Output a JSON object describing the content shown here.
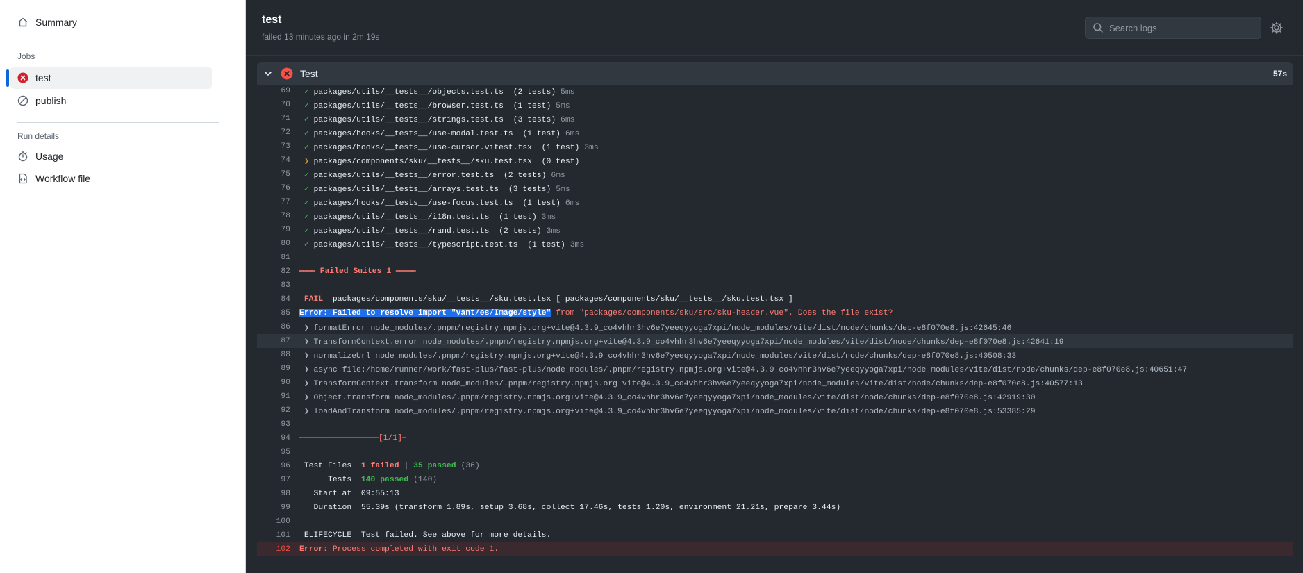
{
  "sidebar": {
    "summary": "Summary",
    "jobs_heading": "Jobs",
    "jobs": [
      {
        "label": "test",
        "status": "failed"
      },
      {
        "label": "publish",
        "status": "skipped"
      }
    ],
    "run_details_heading": "Run details",
    "details": [
      {
        "label": "Usage",
        "icon": "stopwatch-icon"
      },
      {
        "label": "Workflow file",
        "icon": "file-code-icon"
      }
    ]
  },
  "header": {
    "title": "test",
    "subtitle": "failed 13 minutes ago in 2m 19s",
    "search_placeholder": "Search logs"
  },
  "step": {
    "name": "Test",
    "duration": "57s",
    "status": "failed"
  },
  "log": {
    "passed_tests": [
      {
        "n": "69",
        "check": "✓",
        "path": "packages/utils/__tests__/objects.test.ts",
        "count": "(2 tests)",
        "time": "5ms"
      },
      {
        "n": "70",
        "check": "✓",
        "path": "packages/utils/__tests__/browser.test.ts",
        "count": "(1 test)",
        "time": "5ms"
      },
      {
        "n": "71",
        "check": "✓",
        "path": "packages/utils/__tests__/strings.test.ts",
        "count": "(3 tests)",
        "time": "6ms"
      },
      {
        "n": "72",
        "check": "✓",
        "path": "packages/hooks/__tests__/use-modal.test.ts",
        "count": "(1 test)",
        "time": "6ms"
      },
      {
        "n": "73",
        "check": "✓",
        "path": "packages/hooks/__tests__/use-cursor.vitest.tsx",
        "count": "(1 test)",
        "time": "3ms"
      }
    ],
    "line74": {
      "n": "74",
      "mark": "❯",
      "text": "packages/components/sku/__tests__/sku.test.tsx  (0 test)"
    },
    "passed_tests_2": [
      {
        "n": "75",
        "check": "✓",
        "path": "packages/utils/__tests__/error.test.ts",
        "count": "(2 tests)",
        "time": "6ms"
      },
      {
        "n": "76",
        "check": "✓",
        "path": "packages/utils/__tests__/arrays.test.ts",
        "count": "(3 tests)",
        "time": "5ms"
      },
      {
        "n": "77",
        "check": "✓",
        "path": "packages/hooks/__tests__/use-focus.test.ts",
        "count": "(1 test)",
        "time": "6ms"
      },
      {
        "n": "78",
        "check": "✓",
        "path": "packages/utils/__tests__/i18n.test.ts",
        "count": "(1 test)",
        "time": "3ms"
      },
      {
        "n": "79",
        "check": "✓",
        "path": "packages/utils/__tests__/rand.test.ts",
        "count": "(2 tests)",
        "time": "3ms"
      },
      {
        "n": "80",
        "check": "✓",
        "path": "packages/utils/__tests__/typescript.test.ts",
        "count": "(1 test)",
        "time": "3ms"
      }
    ],
    "n81": "81",
    "n82": "82",
    "failed_suites": "⎯⎯⎯⎯ Failed Suites 1 ⎯⎯⎯⎯⎯",
    "n83": "83",
    "n84": "84",
    "fail_badge": " FAIL ",
    "fail_path": " packages/components/sku/__tests__/sku.test.tsx [ packages/components/sku/__tests__/sku.test.tsx ]",
    "n85": "85",
    "error_selected": "Error: Failed to resolve import \"vant/es/Image/style\"",
    "error_rest": " from \"packages/components/sku/src/sku-header.vue\". Does the file exist?",
    "stack": [
      {
        "n": "86",
        "text": " ❯ formatError node_modules/.pnpm/registry.npmjs.org+vite@4.3.9_co4vhhr3hv6e7yeeqyyoga7xpi/node_modules/vite/dist/node/chunks/dep-e8f070e8.js:42645:46"
      },
      {
        "n": "87",
        "text": " ❯ TransformContext.error node_modules/.pnpm/registry.npmjs.org+vite@4.3.9_co4vhhr3hv6e7yeeqyyoga7xpi/node_modules/vite/dist/node/chunks/dep-e8f070e8.js:42641:19"
      },
      {
        "n": "88",
        "text": " ❯ normalizeUrl node_modules/.pnpm/registry.npmjs.org+vite@4.3.9_co4vhhr3hv6e7yeeqyyoga7xpi/node_modules/vite/dist/node/chunks/dep-e8f070e8.js:40508:33"
      },
      {
        "n": "89",
        "text": " ❯ async file:/home/runner/work/fast-plus/fast-plus/node_modules/.pnpm/registry.npmjs.org+vite@4.3.9_co4vhhr3hv6e7yeeqyyoga7xpi/node_modules/vite/dist/node/chunks/dep-e8f070e8.js:40651:47"
      },
      {
        "n": "90",
        "text": " ❯ TransformContext.transform node_modules/.pnpm/registry.npmjs.org+vite@4.3.9_co4vhhr3hv6e7yeeqyyoga7xpi/node_modules/vite/dist/node/chunks/dep-e8f070e8.js:40577:13"
      },
      {
        "n": "91",
        "text": " ❯ Object.transform node_modules/.pnpm/registry.npmjs.org+vite@4.3.9_co4vhhr3hv6e7yeeqyyoga7xpi/node_modules/vite/dist/node/chunks/dep-e8f070e8.js:42919:30"
      },
      {
        "n": "92",
        "text": " ❯ loadAndTransform node_modules/.pnpm/registry.npmjs.org+vite@4.3.9_co4vhhr3hv6e7yeeqyyoga7xpi/node_modules/vite/dist/node/chunks/dep-e8f070e8.js:53385:29"
      }
    ],
    "n93": "93",
    "n94": "94",
    "divider": "⎯⎯⎯⎯⎯⎯⎯⎯⎯⎯⎯⎯⎯⎯⎯⎯⎯⎯⎯⎯[1/1]⎯",
    "n95": "95",
    "n96": "96",
    "test_files_label": " Test Files  ",
    "test_files_failed": "1 failed",
    "test_files_sep": " | ",
    "test_files_passed": "35 passed",
    "test_files_total": " (36)",
    "n97": "97",
    "tests_label": "      Tests  ",
    "tests_passed": "140 passed",
    "tests_total": " (140)",
    "n98": "98",
    "start_label": "   Start at  ",
    "start_value": "09:55:13",
    "n99": "99",
    "duration_label": "   Duration  ",
    "duration_value": "55.39s (transform 1.89s, setup 3.68s, collect 17.46s, tests 1.20s, environment 21.21s, prepare 3.44s)",
    "n100": "100",
    "n101": "101",
    "elifecycle": " ELIFECYCLE  Test failed. See above for more details.",
    "n102": "102",
    "exit_error_label": "Error:",
    "exit_error_text": " Process completed with exit code 1."
  },
  "colors": {
    "accent": "#0969da",
    "fail": "#cf222e",
    "pass": "#3fb950",
    "log_bg": "#24292f"
  }
}
